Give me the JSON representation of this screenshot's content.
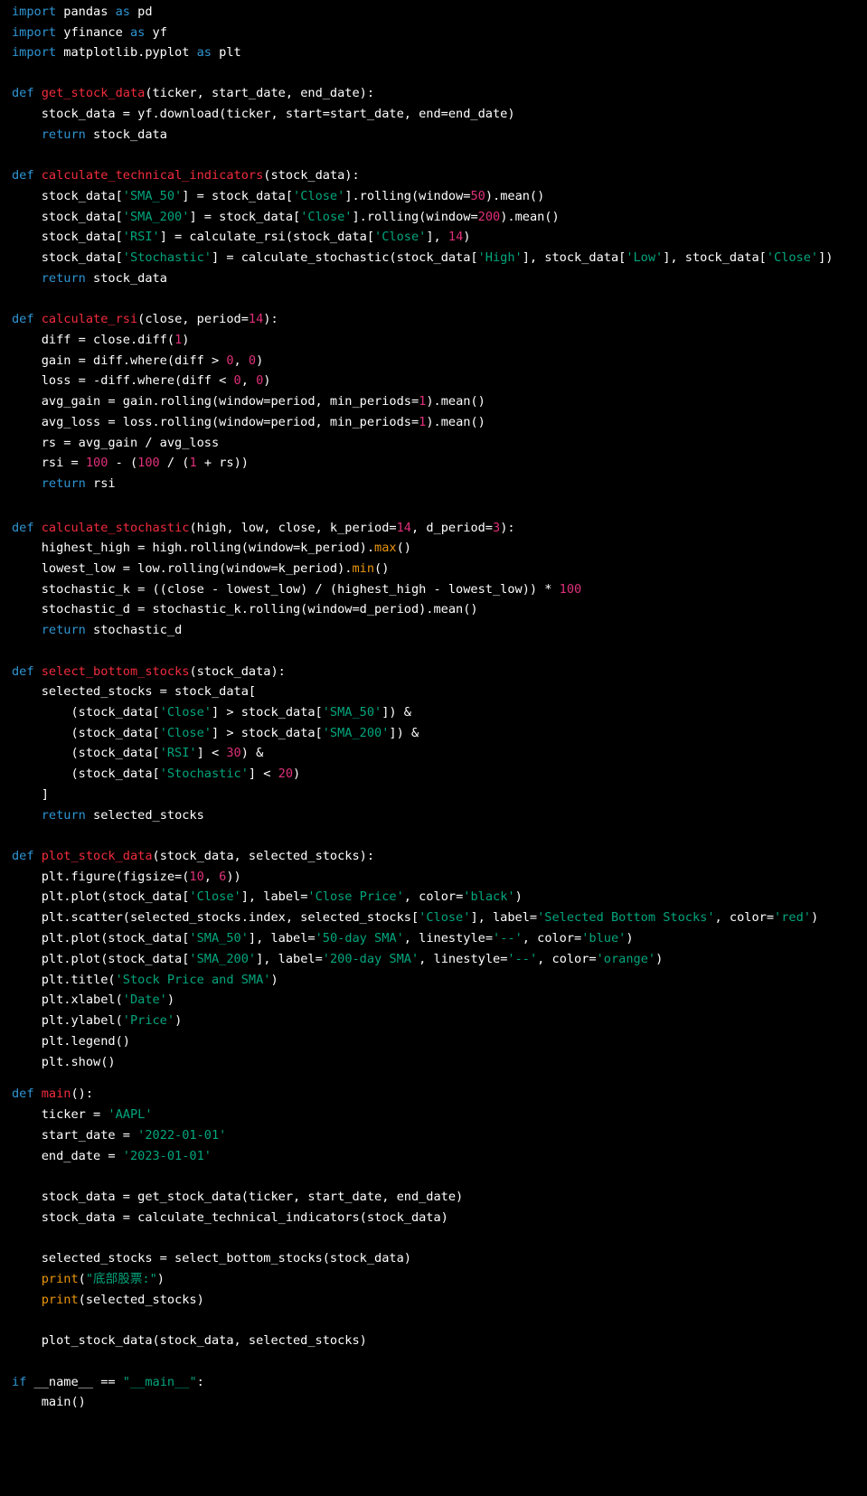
{
  "editor": {
    "background": "#000000",
    "token_colors": {
      "keyword": "#2e95d3",
      "function": "#f22c3d",
      "string": "#00a67d",
      "number": "#df3079",
      "builtin": "#e9950c",
      "text": "#ffffff"
    },
    "lines": [
      [
        [
          "kw",
          "import"
        ],
        [
          "tx",
          " pandas "
        ],
        [
          "kw",
          "as"
        ],
        [
          "tx",
          " pd"
        ]
      ],
      [
        [
          "kw",
          "import"
        ],
        [
          "tx",
          " yfinance "
        ],
        [
          "kw",
          "as"
        ],
        [
          "tx",
          " yf"
        ]
      ],
      [
        [
          "kw",
          "import"
        ],
        [
          "tx",
          " matplotlib.pyplot "
        ],
        [
          "kw",
          "as"
        ],
        [
          "tx",
          " plt"
        ]
      ],
      [],
      [
        [
          "kw",
          "def"
        ],
        [
          "tx",
          " "
        ],
        [
          "fn",
          "get_stock_data"
        ],
        [
          "tx",
          "(ticker, start_date, end_date):"
        ]
      ],
      [
        [
          "tx",
          "    stock_data = yf.download(ticker, start=start_date, end=end_date)"
        ]
      ],
      [
        [
          "tx",
          "    "
        ],
        [
          "kw",
          "return"
        ],
        [
          "tx",
          " stock_data"
        ]
      ],
      [],
      [
        [
          "kw",
          "def"
        ],
        [
          "tx",
          " "
        ],
        [
          "fn",
          "calculate_technical_indicators"
        ],
        [
          "tx",
          "(stock_data):"
        ]
      ],
      [
        [
          "tx",
          "    stock_data["
        ],
        [
          "st",
          "'SMA_50'"
        ],
        [
          "tx",
          "] = stock_data["
        ],
        [
          "st",
          "'Close'"
        ],
        [
          "tx",
          "].rolling(window="
        ],
        [
          "nu",
          "50"
        ],
        [
          "tx",
          ").mean()"
        ]
      ],
      [
        [
          "tx",
          "    stock_data["
        ],
        [
          "st",
          "'SMA_200'"
        ],
        [
          "tx",
          "] = stock_data["
        ],
        [
          "st",
          "'Close'"
        ],
        [
          "tx",
          "].rolling(window="
        ],
        [
          "nu",
          "200"
        ],
        [
          "tx",
          ").mean()"
        ]
      ],
      [
        [
          "tx",
          "    stock_data["
        ],
        [
          "st",
          "'RSI'"
        ],
        [
          "tx",
          "] = calculate_rsi(stock_data["
        ],
        [
          "st",
          "'Close'"
        ],
        [
          "tx",
          "], "
        ],
        [
          "nu",
          "14"
        ],
        [
          "tx",
          ")"
        ]
      ],
      [
        [
          "tx",
          "    stock_data["
        ],
        [
          "st",
          "'Stochastic'"
        ],
        [
          "tx",
          "] = calculate_stochastic(stock_data["
        ],
        [
          "st",
          "'High'"
        ],
        [
          "tx",
          "], stock_data["
        ],
        [
          "st",
          "'Low'"
        ],
        [
          "tx",
          "], stock_data["
        ],
        [
          "st",
          "'Close'"
        ],
        [
          "tx",
          "])"
        ]
      ],
      [
        [
          "tx",
          "    "
        ],
        [
          "kw",
          "return"
        ],
        [
          "tx",
          " stock_data"
        ]
      ],
      [],
      [
        [
          "kw",
          "def"
        ],
        [
          "tx",
          " "
        ],
        [
          "fn",
          "calculate_rsi"
        ],
        [
          "tx",
          "(close, period="
        ],
        [
          "nu",
          "14"
        ],
        [
          "tx",
          "):"
        ]
      ],
      [
        [
          "tx",
          "    diff = close.diff("
        ],
        [
          "nu",
          "1"
        ],
        [
          "tx",
          ")"
        ]
      ],
      [
        [
          "tx",
          "    gain = diff.where(diff > "
        ],
        [
          "nu",
          "0"
        ],
        [
          "tx",
          ", "
        ],
        [
          "nu",
          "0"
        ],
        [
          "tx",
          ")"
        ]
      ],
      [
        [
          "tx",
          "    loss = -diff.where(diff < "
        ],
        [
          "nu",
          "0"
        ],
        [
          "tx",
          ", "
        ],
        [
          "nu",
          "0"
        ],
        [
          "tx",
          ")"
        ]
      ],
      [
        [
          "tx",
          "    avg_gain = gain.rolling(window=period, min_periods="
        ],
        [
          "nu",
          "1"
        ],
        [
          "tx",
          ").mean()"
        ]
      ],
      [
        [
          "tx",
          "    avg_loss = loss.rolling(window=period, min_periods="
        ],
        [
          "nu",
          "1"
        ],
        [
          "tx",
          ").mean()"
        ]
      ],
      [
        [
          "tx",
          "    rs = avg_gain / avg_loss"
        ]
      ],
      [
        [
          "tx",
          "    rsi = "
        ],
        [
          "nu",
          "100"
        ],
        [
          "tx",
          " - ("
        ],
        [
          "nu",
          "100"
        ],
        [
          "tx",
          " / ("
        ],
        [
          "nu",
          "1"
        ],
        [
          "tx",
          " + rs))"
        ]
      ],
      [
        [
          "tx",
          "    "
        ],
        [
          "kw",
          "return"
        ],
        [
          "tx",
          " rsi"
        ]
      ],
      [],
      [
        [
          "kw",
          "def"
        ],
        [
          "tx",
          " "
        ],
        [
          "fn",
          "calculate_stochastic"
        ],
        [
          "tx",
          "(high, low, close, k_period="
        ],
        [
          "nu",
          "14"
        ],
        [
          "tx",
          ", d_period="
        ],
        [
          "nu",
          "3"
        ],
        [
          "tx",
          "):"
        ]
      ],
      [
        [
          "tx",
          "    highest_high = high.rolling(window=k_period)."
        ],
        [
          "bi",
          "max"
        ],
        [
          "tx",
          "()"
        ]
      ],
      [
        [
          "tx",
          "    lowest_low = low.rolling(window=k_period)."
        ],
        [
          "bi",
          "min"
        ],
        [
          "tx",
          "()"
        ]
      ],
      [
        [
          "tx",
          "    stochastic_k = ((close - lowest_low) / (highest_high - lowest_low)) * "
        ],
        [
          "nu",
          "100"
        ]
      ],
      [
        [
          "tx",
          "    stochastic_d = stochastic_k.rolling(window=d_period).mean()"
        ]
      ],
      [
        [
          "tx",
          "    "
        ],
        [
          "kw",
          "return"
        ],
        [
          "tx",
          " stochastic_d"
        ]
      ],
      [],
      [
        [
          "kw",
          "def"
        ],
        [
          "tx",
          " "
        ],
        [
          "fn",
          "select_bottom_stocks"
        ],
        [
          "tx",
          "(stock_data):"
        ]
      ],
      [
        [
          "tx",
          "    selected_stocks = stock_data["
        ]
      ],
      [
        [
          "tx",
          "        (stock_data["
        ],
        [
          "st",
          "'Close'"
        ],
        [
          "tx",
          "] > stock_data["
        ],
        [
          "st",
          "'SMA_50'"
        ],
        [
          "tx",
          "]) &"
        ]
      ],
      [
        [
          "tx",
          "        (stock_data["
        ],
        [
          "st",
          "'Close'"
        ],
        [
          "tx",
          "] > stock_data["
        ],
        [
          "st",
          "'SMA_200'"
        ],
        [
          "tx",
          "]) &"
        ]
      ],
      [
        [
          "tx",
          "        (stock_data["
        ],
        [
          "st",
          "'RSI'"
        ],
        [
          "tx",
          "] < "
        ],
        [
          "nu",
          "30"
        ],
        [
          "tx",
          ") &"
        ]
      ],
      [
        [
          "tx",
          "        (stock_data["
        ],
        [
          "st",
          "'Stochastic'"
        ],
        [
          "tx",
          "] < "
        ],
        [
          "nu",
          "20"
        ],
        [
          "tx",
          ")"
        ]
      ],
      [
        [
          "tx",
          "    ]"
        ]
      ],
      [
        [
          "tx",
          "    "
        ],
        [
          "kw",
          "return"
        ],
        [
          "tx",
          " selected_stocks"
        ]
      ],
      [],
      [
        [
          "kw",
          "def"
        ],
        [
          "tx",
          " "
        ],
        [
          "fn",
          "plot_stock_data"
        ],
        [
          "tx",
          "(stock_data, selected_stocks):"
        ]
      ],
      [
        [
          "tx",
          "    plt.figure(figsize=("
        ],
        [
          "nu",
          "10"
        ],
        [
          "tx",
          ", "
        ],
        [
          "nu",
          "6"
        ],
        [
          "tx",
          "))"
        ]
      ],
      [
        [
          "tx",
          "    plt.plot(stock_data["
        ],
        [
          "st",
          "'Close'"
        ],
        [
          "tx",
          "], label="
        ],
        [
          "st",
          "'Close Price'"
        ],
        [
          "tx",
          ", color="
        ],
        [
          "st",
          "'black'"
        ],
        [
          "tx",
          ")"
        ]
      ],
      [
        [
          "tx",
          "    plt.scatter(selected_stocks.index, selected_stocks["
        ],
        [
          "st",
          "'Close'"
        ],
        [
          "tx",
          "], label="
        ],
        [
          "st",
          "'Selected Bottom Stocks'"
        ],
        [
          "tx",
          ", color="
        ],
        [
          "st",
          "'red'"
        ],
        [
          "tx",
          ")"
        ]
      ],
      [
        [
          "tx",
          "    plt.plot(stock_data["
        ],
        [
          "st",
          "'SMA_50'"
        ],
        [
          "tx",
          "], label="
        ],
        [
          "st",
          "'50-day SMA'"
        ],
        [
          "tx",
          ", linestyle="
        ],
        [
          "st",
          "'--'"
        ],
        [
          "tx",
          ", color="
        ],
        [
          "st",
          "'blue'"
        ],
        [
          "tx",
          ")"
        ]
      ],
      [
        [
          "tx",
          "    plt.plot(stock_data["
        ],
        [
          "st",
          "'SMA_200'"
        ],
        [
          "tx",
          "], label="
        ],
        [
          "st",
          "'200-day SMA'"
        ],
        [
          "tx",
          ", linestyle="
        ],
        [
          "st",
          "'--'"
        ],
        [
          "tx",
          ", color="
        ],
        [
          "st",
          "'orange'"
        ],
        [
          "tx",
          ")"
        ]
      ],
      [
        [
          "tx",
          "    plt.title("
        ],
        [
          "st",
          "'Stock Price and SMA'"
        ],
        [
          "tx",
          ")"
        ]
      ],
      [
        [
          "tx",
          "    plt.xlabel("
        ],
        [
          "st",
          "'Date'"
        ],
        [
          "tx",
          ")"
        ]
      ],
      [
        [
          "tx",
          "    plt.ylabel("
        ],
        [
          "st",
          "'Price'"
        ],
        [
          "tx",
          ")"
        ]
      ],
      [
        [
          "tx",
          "    plt.legend()"
        ]
      ],
      [
        [
          "tx",
          "    plt.show()"
        ]
      ],
      [],
      [
        [
          "kw",
          "def"
        ],
        [
          "tx",
          " "
        ],
        [
          "fn",
          "main"
        ],
        [
          "tx",
          "():"
        ]
      ],
      [
        [
          "tx",
          "    ticker = "
        ],
        [
          "st",
          "'AAPL'"
        ]
      ],
      [
        [
          "tx",
          "    start_date = "
        ],
        [
          "st",
          "'2022-01-01'"
        ]
      ],
      [
        [
          "tx",
          "    end_date = "
        ],
        [
          "st",
          "'2023-01-01'"
        ]
      ],
      [],
      [
        [
          "tx",
          "    stock_data = get_stock_data(ticker, start_date, end_date)"
        ]
      ],
      [
        [
          "tx",
          "    stock_data = calculate_technical_indicators(stock_data)"
        ]
      ],
      [],
      [
        [
          "tx",
          "    selected_stocks = select_bottom_stocks(stock_data)"
        ]
      ],
      [
        [
          "tx",
          "    "
        ],
        [
          "bi",
          "print"
        ],
        [
          "tx",
          "("
        ],
        [
          "st",
          "\"底部股票:\""
        ],
        [
          "tx",
          ")"
        ]
      ],
      [
        [
          "tx",
          "    "
        ],
        [
          "bi",
          "print"
        ],
        [
          "tx",
          "(selected_stocks)"
        ]
      ],
      [],
      [
        [
          "tx",
          "    plot_stock_data(stock_data, selected_stocks)"
        ]
      ],
      [],
      [
        [
          "kw",
          "if"
        ],
        [
          "tx",
          " __name__ == "
        ],
        [
          "st",
          "\"__main__\""
        ],
        [
          "tx",
          ":"
        ]
      ],
      [
        [
          "tx",
          "    main()"
        ]
      ]
    ]
  }
}
